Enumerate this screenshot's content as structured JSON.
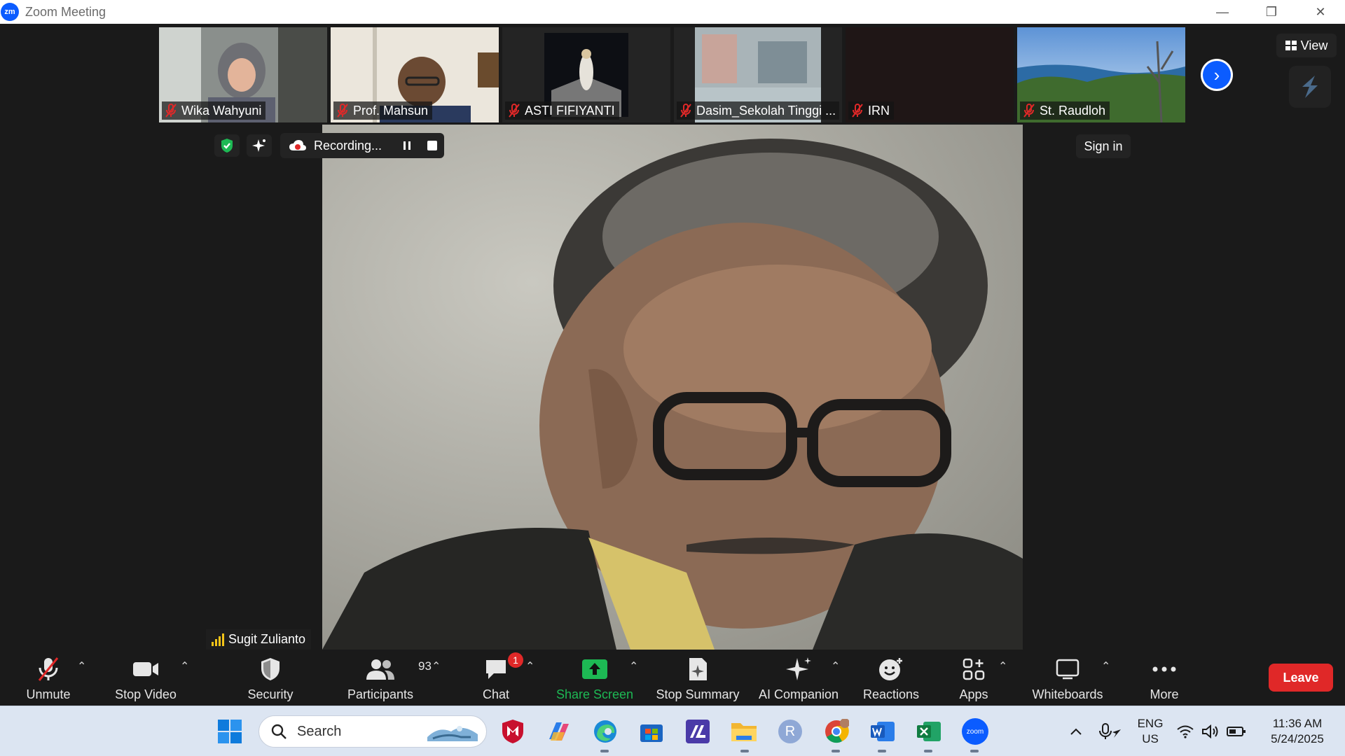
{
  "window": {
    "app_logo": "zm",
    "title": "Zoom Meeting",
    "minimize": "—",
    "restore": "❐",
    "close": "✕"
  },
  "gallery": [
    {
      "name": "Wika Wahyuni"
    },
    {
      "name": "Prof. Mahsun"
    },
    {
      "name": "ASTI FIFIYANTI"
    },
    {
      "name": "Dasim_Sekolah Tinggi ..."
    },
    {
      "name": "IRN"
    },
    {
      "name": "St. Raudloh"
    }
  ],
  "top_right": {
    "view_label": "View",
    "sign_in_label": "Sign in"
  },
  "recording": {
    "label": "Recording..."
  },
  "active_speaker": {
    "name": "Sugit Zulianto"
  },
  "toolbar": {
    "unmute": "Unmute",
    "stop_video": "Stop Video",
    "security": "Security",
    "participants": "Participants",
    "participants_count": "93",
    "chat": "Chat",
    "chat_badge": "1",
    "share_screen": "Share Screen",
    "stop_summary": "Stop Summary",
    "ai_companion": "AI Companion",
    "reactions": "Reactions",
    "apps": "Apps",
    "whiteboards": "Whiteboards",
    "more": "More",
    "leave": "Leave"
  },
  "taskbar": {
    "search_placeholder": "Search",
    "lang_top": "ENG",
    "lang_bottom": "US",
    "time": "11:36 AM",
    "date": "5/24/2025",
    "r_app_letter": "R",
    "zoom_app_text": "zoom"
  },
  "colors": {
    "accent": "#0b5cff",
    "leave": "#e02828",
    "share_green": "#1db954",
    "muted_red": "#e02828"
  }
}
